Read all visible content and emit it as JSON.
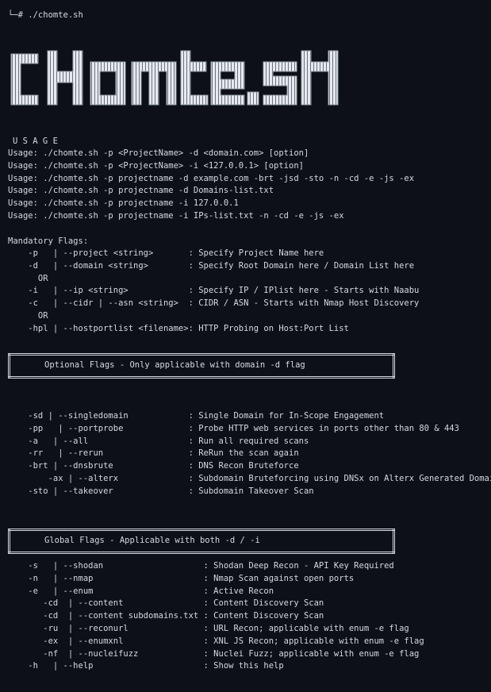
{
  "prompt_line": "└─# ./chomte.sh",
  "logo_text": "CHOMTE.SH",
  "usage_header": "U S A G E",
  "usage_lines": [
    "Usage: ./chomte.sh -p <ProjectName> -d <domain.com> [option]",
    "Usage: ./chomte.sh -p <ProjectName> -i <127.0.0.1> [option]",
    "Usage: ./chomte.sh -p projectname -d example.com -brt -jsd -sto -n -cd -e -js -ex",
    "Usage: ./chomte.sh -p projectname -d Domains-list.txt",
    "Usage: ./chomte.sh -p projectname -i 127.0.0.1",
    "Usage: ./chomte.sh -p projectname -i IPs-list.txt -n -cd -e -js -ex"
  ],
  "mandatory_title": "Mandatory Flags:",
  "mandatory_lines": [
    "    -p   | --project <string>       : Specify Project Name here",
    "    -d   | --domain <string>        : Specify Root Domain here / Domain List here",
    "      OR",
    "    -i   | --ip <string>            : Specify IP / IPlist here - Starts with Naabu",
    "    -c   | --cidr | --asn <string>  : CIDR / ASN - Starts with Nmap Host Discovery",
    "      OR",
    "    -hpl | --hostportlist <filename>: HTTP Probing on Host:Port List"
  ],
  "optional_title": "Optional Flags - Only applicable with domain -d flag",
  "optional_lines": [
    "    -sd | --singledomain            : Single Domain for In-Scope Engagement",
    "    -pp   | --portprobe             : Probe HTTP web services in ports other than 80 & 443",
    "    -a   | --all                    : Run all required scans",
    "    -rr   | --rerun                 : ReRun the scan again",
    "    -brt | --dnsbrute               : DNS Recon Bruteforce",
    "        -ax | --alterx              : Subdomain Bruteforcing using DNSx on Alterx Generated Domains",
    "    -sto | --takeover               : Subdomain Takeover Scan"
  ],
  "global_title": "Global Flags - Applicable with both -d / -i",
  "global_lines": [
    "    -s   | --shodan                    : Shodan Deep Recon - API Key Required",
    "    -n   | --nmap                      : Nmap Scan against open ports",
    "    -e   | --enum                      : Active Recon",
    "       -cd  | --content                : Content Discovery Scan",
    "       -cd  | --content subdomains.txt : Content Discovery Scan",
    "       -ru  | --reconurl               : URL Recon; applicable with enum -e flag",
    "       -ex  | --enumxnl                : XNL JS Recon; applicable with enum -e flag",
    "       -nf  | --nucleifuzz             : Nuclei Fuzz; applicable with enum -e flag",
    "    -h   | --help                      : Show this help"
  ]
}
